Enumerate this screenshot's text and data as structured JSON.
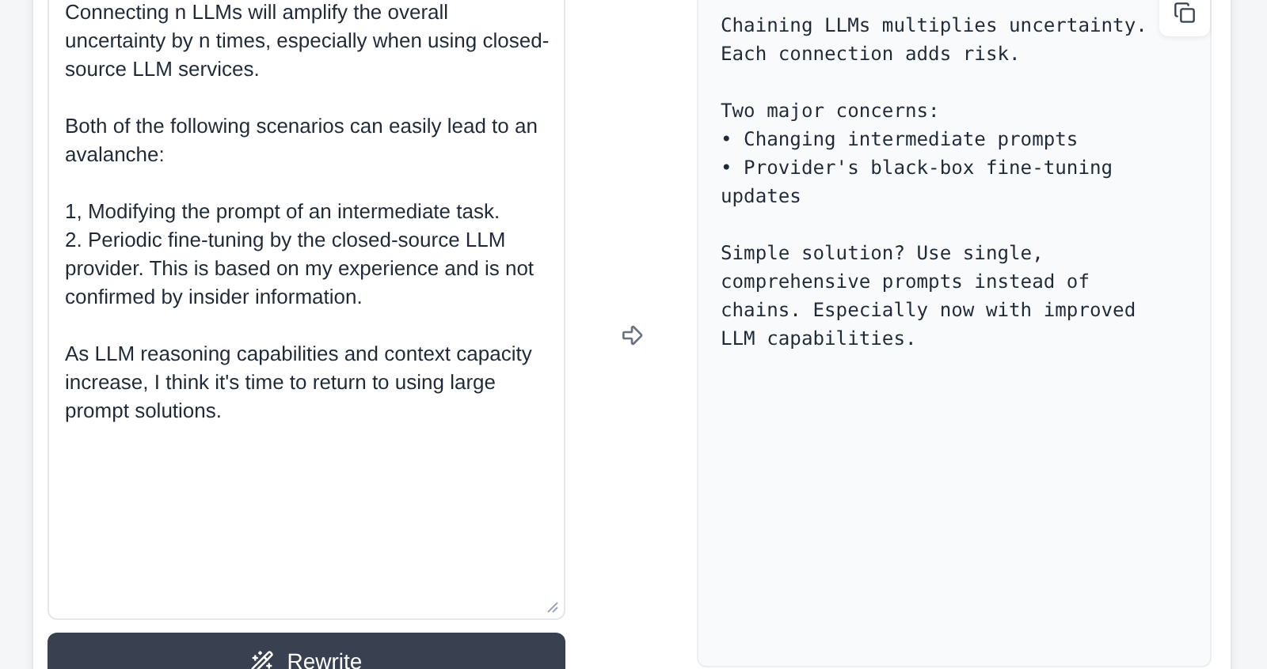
{
  "input": {
    "text": "Connecting n LLMs will amplify the overall uncertainty by n times, especially when using closed-source LLM services.\n\nBoth of the following scenarios can easily lead to an avalanche:\n\n1, Modifying the prompt of an intermediate task.\n2. Periodic fine-tuning by the closed-source LLM provider. This is based on my experience and is not confirmed by insider information.\n\nAs LLM reasoning capabilities and context capacity increase, I think it's time to return to using large prompt solutions."
  },
  "rewrite_button": {
    "label": "Rewrite"
  },
  "output": {
    "text": "Chaining LLMs multiplies uncertainty.\nEach connection adds risk.\n\nTwo major concerns:\n• Changing intermediate prompts\n• Provider's black-box fine-tuning\nupdates\n\nSimple solution? Use single,\ncomprehensive prompts instead of\nchains. Especially now with improved\nLLM capabilities."
  }
}
